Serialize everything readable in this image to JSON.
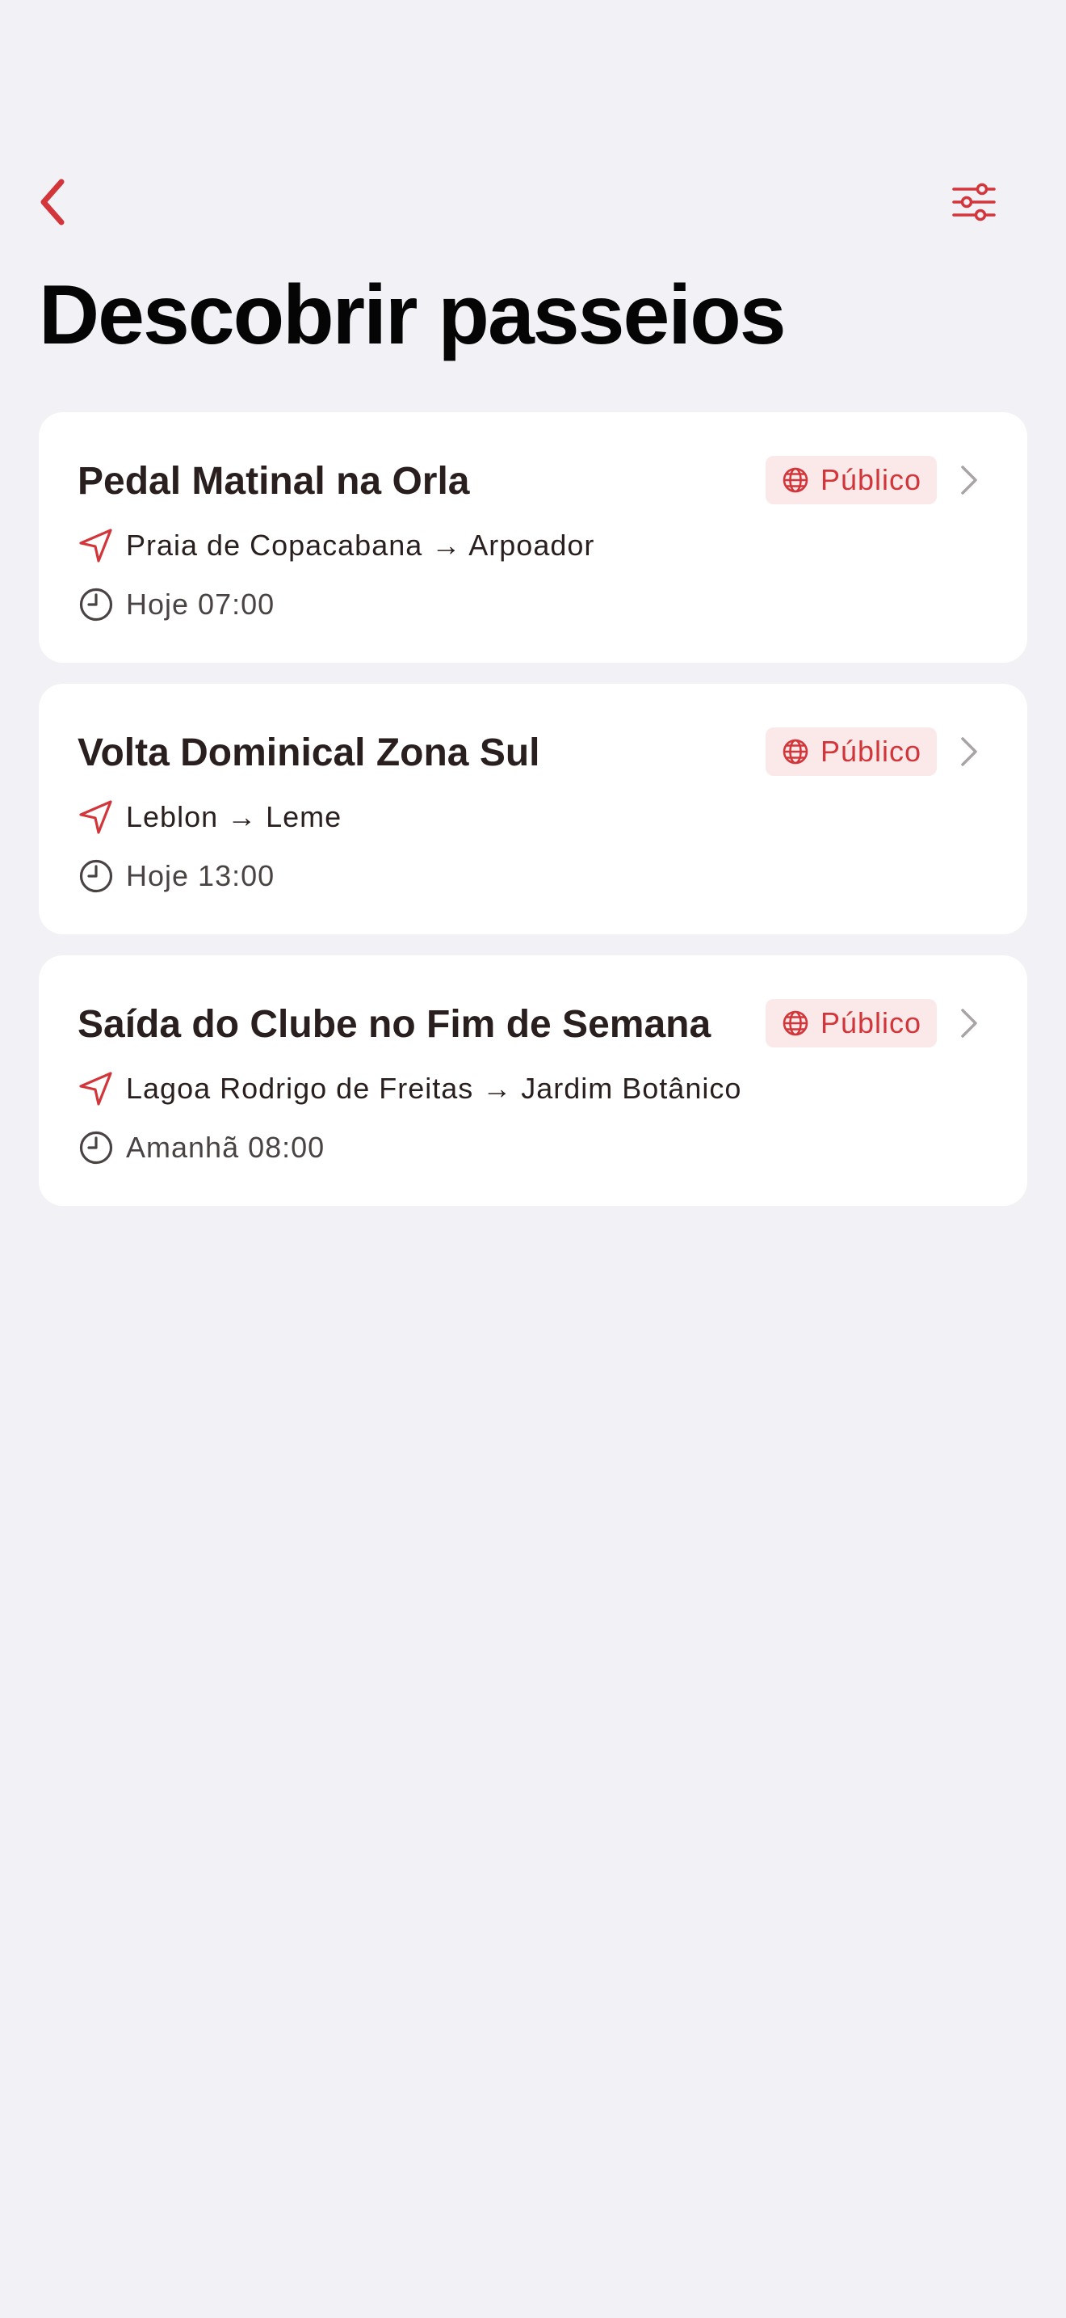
{
  "header": {
    "title": "Descobrir passeios",
    "back_icon": "chevron-left-icon",
    "filter_icon": "sliders-icon"
  },
  "colors": {
    "background": "#f2f1f6",
    "card": "#ffffff",
    "accent": "#d2363a",
    "badge_background": "#fbe9e9",
    "title_text": "#2a1f1f",
    "secondary_text": "#4a4343",
    "chevron": "#a8a4a4"
  },
  "rides": [
    {
      "title": "Pedal Matinal na Orla",
      "badge": "Público",
      "route": "Praia de Copacabana → Arpoador",
      "time": "Hoje 07:00"
    },
    {
      "title": "Volta Dominical Zona Sul",
      "badge": "Público",
      "route": "Leblon → Leme",
      "time": "Hoje 13:00"
    },
    {
      "title": "Saída do Clube no Fim de Semana",
      "badge": "Público",
      "route": "Lagoa Rodrigo de Freitas → Jardim Botânico",
      "time": "Amanhã 08:00"
    }
  ]
}
